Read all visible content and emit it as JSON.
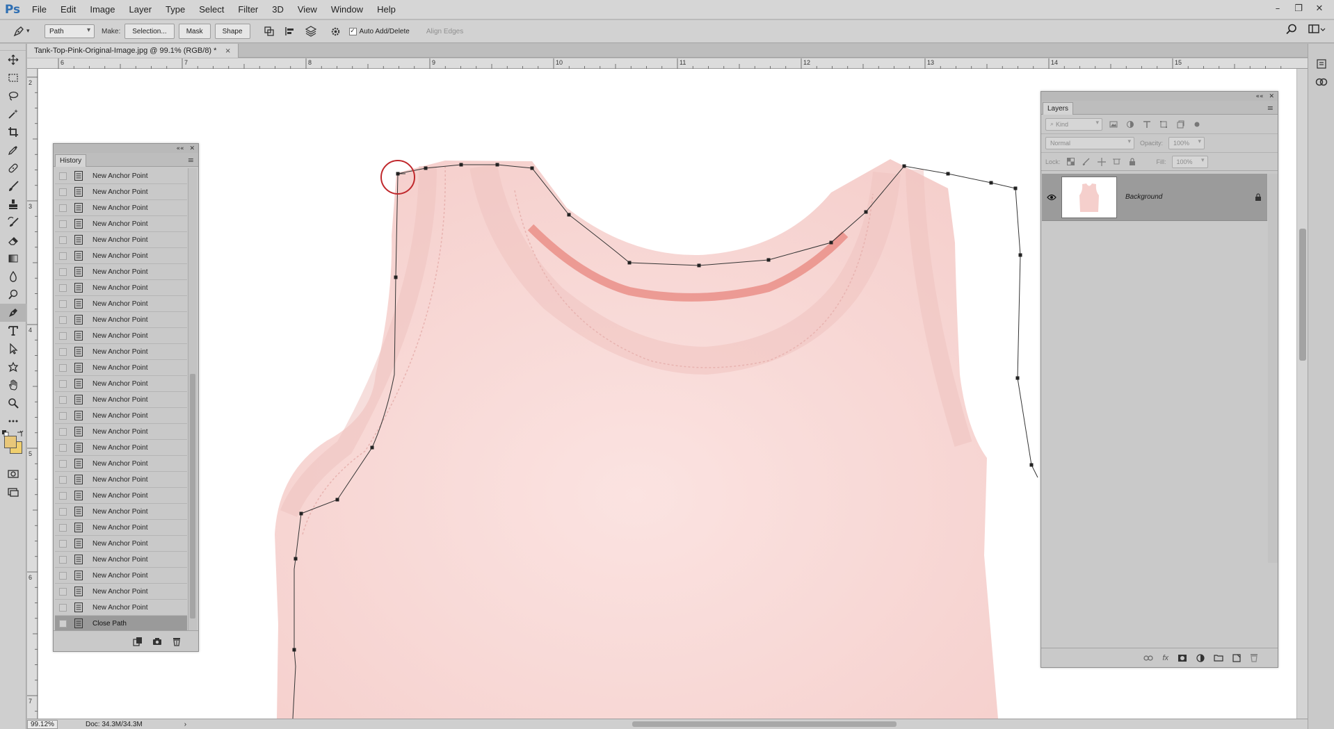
{
  "app": {
    "logo": "Ps"
  },
  "menu": [
    "File",
    "Edit",
    "Image",
    "Layer",
    "Type",
    "Select",
    "Filter",
    "3D",
    "View",
    "Window",
    "Help"
  ],
  "options": {
    "mode_value": "Path",
    "make_label": "Make:",
    "selection_button": "Selection...",
    "mask_button": "Mask",
    "shape_button": "Shape",
    "auto_add_delete_label": "Auto Add/Delete",
    "auto_add_delete_checked": "✓",
    "align_edges_label": "Align Edges"
  },
  "document": {
    "tab_title": "Tank-Top-Pink-Original-Image.jpg @ 99.1% (RGB/8) *",
    "close_glyph": "×",
    "ruler_h_labels": [
      "6",
      "7",
      "8",
      "9",
      "10",
      "11",
      "12",
      "13",
      "14",
      "15"
    ],
    "ruler_v_labels": [
      "2",
      "3",
      "4",
      "5",
      "6",
      "7"
    ]
  },
  "status": {
    "zoom": "99.12%",
    "doc_info": "Doc: 34.3M/34.3M",
    "arrow": "›"
  },
  "history": {
    "title": "History",
    "items": [
      "New Anchor Point",
      "New Anchor Point",
      "New Anchor Point",
      "New Anchor Point",
      "New Anchor Point",
      "New Anchor Point",
      "New Anchor Point",
      "New Anchor Point",
      "New Anchor Point",
      "New Anchor Point",
      "New Anchor Point",
      "New Anchor Point",
      "New Anchor Point",
      "New Anchor Point",
      "New Anchor Point",
      "New Anchor Point",
      "New Anchor Point",
      "New Anchor Point",
      "New Anchor Point",
      "New Anchor Point",
      "New Anchor Point",
      "New Anchor Point",
      "New Anchor Point",
      "New Anchor Point",
      "New Anchor Point",
      "New Anchor Point",
      "New Anchor Point",
      "New Anchor Point",
      "Close Path"
    ],
    "selected_item": "Close Path"
  },
  "layers": {
    "title": "Layers",
    "filter_kind": "Kind",
    "blend_mode": "Normal",
    "opacity_label": "Opacity:",
    "opacity_value": "100%",
    "lock_label": "Lock:",
    "fill_label": "Fill:",
    "fill_value": "100%",
    "layer_name": "Background",
    "footer_fx": "fx"
  },
  "colors": {
    "foreground": "#e8c77a",
    "background": "#f0cf6e",
    "shirt": "#f8d8d6",
    "collar_stitch": "#e8857e",
    "selection_circle": "#c0282c"
  }
}
